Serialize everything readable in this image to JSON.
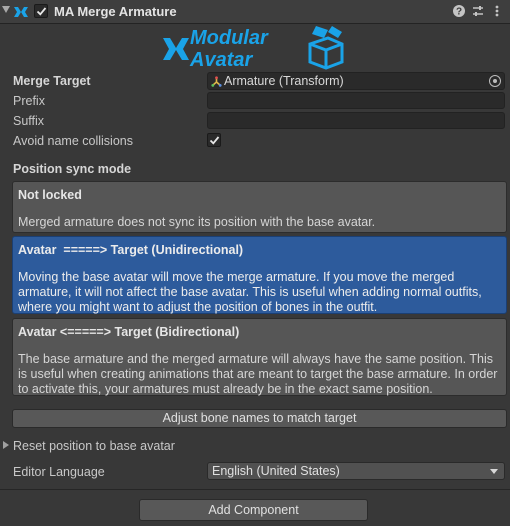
{
  "header": {
    "title": "MA Merge Armature",
    "enabled": true
  },
  "logo": {
    "line1": "Modular",
    "line2": "Avatar"
  },
  "fields": {
    "merge_target_label": "Merge Target",
    "merge_target_value": "Armature (Transform)",
    "prefix_label": "Prefix",
    "prefix_value": "",
    "suffix_label": "Suffix",
    "suffix_value": "",
    "avoid_collisions_label": "Avoid name collisions",
    "avoid_collisions_checked": true
  },
  "position_sync": {
    "heading": "Position sync mode",
    "options": [
      {
        "title": "Not locked",
        "description": "Merged armature does not sync its position with the base avatar.",
        "selected": false
      },
      {
        "title": "Avatar  =====> Target (Unidirectional)",
        "description": "Moving the base avatar will move the merge armature. If you move the merged armature, it will not affect the base avatar. This is useful when adding normal outfits, where you might want to adjust the position of bones in the outfit.",
        "selected": true
      },
      {
        "title": "Avatar <=====> Target (Bidirectional)",
        "description": "The base armature and the merged armature will always have the same position. This is useful when creating animations that are meant to target the base armature. In order to activate this, your armatures must already be in the exact same position.",
        "selected": false
      }
    ]
  },
  "adjust_button": "Adjust bone names to match target",
  "reset_foldout": "Reset position to base avatar",
  "language": {
    "label": "Editor Language",
    "value": "English (United States)"
  },
  "add_component": "Add Component",
  "colors": {
    "accent_selected": "#2d5b9c",
    "logo_blue": "#1aa3e8"
  }
}
